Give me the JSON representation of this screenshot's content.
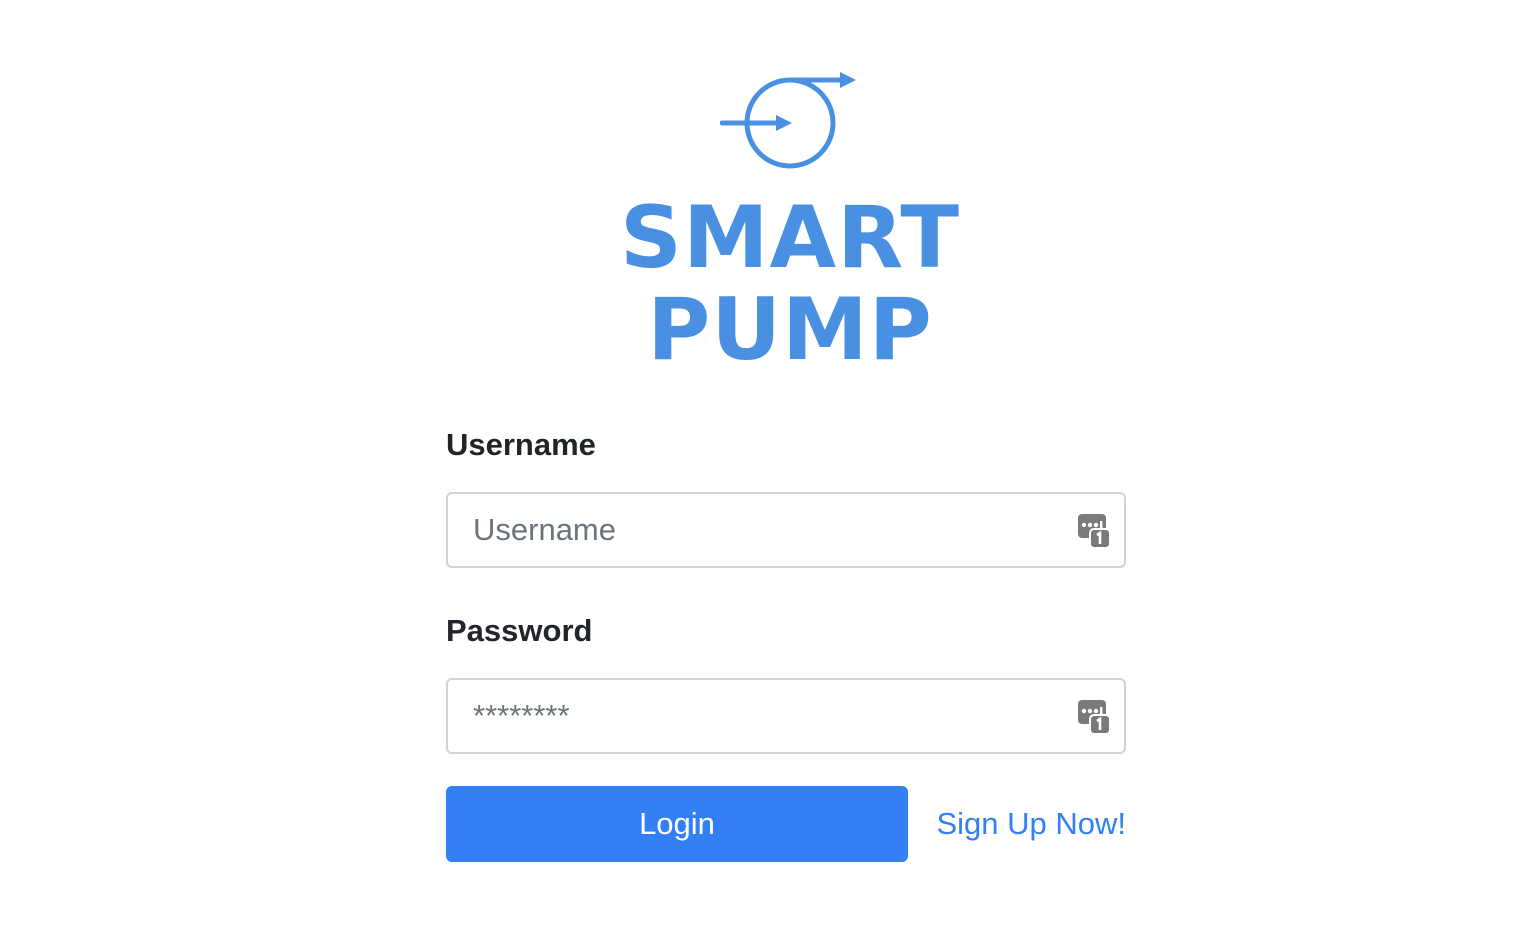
{
  "brand": {
    "logo_line1": "SMART",
    "logo_line2": "PUMP",
    "color": "#4a90e2",
    "logo_icon": "pump-arrow-logo-icon"
  },
  "form": {
    "username": {
      "label": "Username",
      "placeholder": "Username",
      "value": "",
      "icon": "password-manager-key-icon"
    },
    "password": {
      "label": "Password",
      "placeholder": "********",
      "value": "",
      "icon": "password-manager-key-icon"
    }
  },
  "actions": {
    "login_label": "Login",
    "signup_label": "Sign Up Now!",
    "primary_color": "#3380f4"
  }
}
